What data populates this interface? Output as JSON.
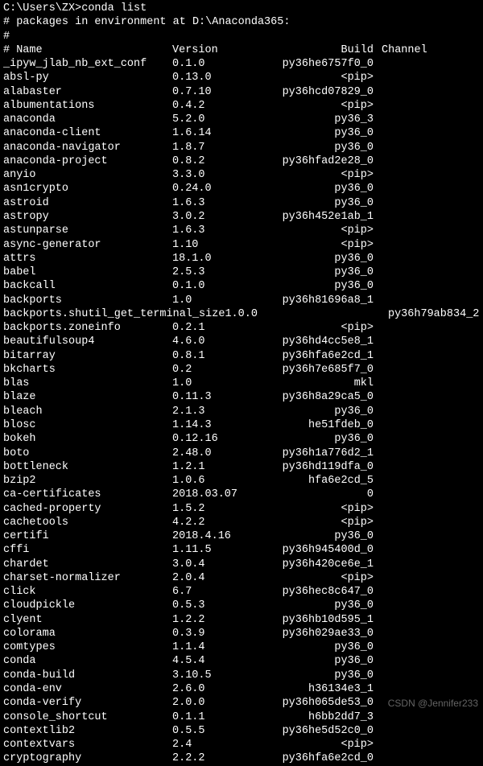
{
  "prompt": {
    "path": "C:\\Users\\ZX>",
    "command": "conda list"
  },
  "env_line": "# packages in environment at D:\\Anaconda365:",
  "hash_line": "#",
  "header": {
    "name": "# Name",
    "version": "Version",
    "build": "Build",
    "channel": "Channel"
  },
  "packages": [
    {
      "name": "_ipyw_jlab_nb_ext_conf",
      "version": "0.1.0",
      "build": "py36he6757f0_0",
      "channel": ""
    },
    {
      "name": "absl-py",
      "version": "0.13.0",
      "build": "<pip>",
      "channel": ""
    },
    {
      "name": "alabaster",
      "version": "0.7.10",
      "build": "py36hcd07829_0",
      "channel": ""
    },
    {
      "name": "albumentations",
      "version": "0.4.2",
      "build": "<pip>",
      "channel": ""
    },
    {
      "name": "anaconda",
      "version": "5.2.0",
      "build": "py36_3",
      "channel": ""
    },
    {
      "name": "anaconda-client",
      "version": "1.6.14",
      "build": "py36_0",
      "channel": ""
    },
    {
      "name": "anaconda-navigator",
      "version": "1.8.7",
      "build": "py36_0",
      "channel": ""
    },
    {
      "name": "anaconda-project",
      "version": "0.8.2",
      "build": "py36hfad2e28_0",
      "channel": ""
    },
    {
      "name": "anyio",
      "version": "3.3.0",
      "build": "<pip>",
      "channel": ""
    },
    {
      "name": "asn1crypto",
      "version": "0.24.0",
      "build": "py36_0",
      "channel": ""
    },
    {
      "name": "astroid",
      "version": "1.6.3",
      "build": "py36_0",
      "channel": ""
    },
    {
      "name": "astropy",
      "version": "3.0.2",
      "build": "py36h452e1ab_1",
      "channel": ""
    },
    {
      "name": "astunparse",
      "version": "1.6.3",
      "build": "<pip>",
      "channel": ""
    },
    {
      "name": "async-generator",
      "version": "1.10",
      "build": "<pip>",
      "channel": ""
    },
    {
      "name": "attrs",
      "version": "18.1.0",
      "build": "py36_0",
      "channel": ""
    },
    {
      "name": "babel",
      "version": "2.5.3",
      "build": "py36_0",
      "channel": ""
    },
    {
      "name": "backcall",
      "version": "0.1.0",
      "build": "py36_0",
      "channel": ""
    },
    {
      "name": "backports",
      "version": "1.0",
      "build": "py36h81696a8_1",
      "channel": ""
    },
    {
      "name": "backports.shutil_get_terminal_size",
      "version": "1.0.0",
      "build": "py36h79ab834_2",
      "channel": "",
      "wide": true
    },
    {
      "name": "backports.zoneinfo",
      "version": "0.2.1",
      "build": "<pip>",
      "channel": ""
    },
    {
      "name": "beautifulsoup4",
      "version": "4.6.0",
      "build": "py36hd4cc5e8_1",
      "channel": ""
    },
    {
      "name": "bitarray",
      "version": "0.8.1",
      "build": "py36hfa6e2cd_1",
      "channel": ""
    },
    {
      "name": "bkcharts",
      "version": "0.2",
      "build": "py36h7e685f7_0",
      "channel": ""
    },
    {
      "name": "blas",
      "version": "1.0",
      "build": "mkl",
      "channel": ""
    },
    {
      "name": "blaze",
      "version": "0.11.3",
      "build": "py36h8a29ca5_0",
      "channel": ""
    },
    {
      "name": "bleach",
      "version": "2.1.3",
      "build": "py36_0",
      "channel": ""
    },
    {
      "name": "blosc",
      "version": "1.14.3",
      "build": "he51fdeb_0",
      "channel": ""
    },
    {
      "name": "bokeh",
      "version": "0.12.16",
      "build": "py36_0",
      "channel": ""
    },
    {
      "name": "boto",
      "version": "2.48.0",
      "build": "py36h1a776d2_1",
      "channel": ""
    },
    {
      "name": "bottleneck",
      "version": "1.2.1",
      "build": "py36hd119dfa_0",
      "channel": ""
    },
    {
      "name": "bzip2",
      "version": "1.0.6",
      "build": "hfa6e2cd_5",
      "channel": ""
    },
    {
      "name": "ca-certificates",
      "version": "2018.03.07",
      "build": "0",
      "channel": ""
    },
    {
      "name": "cached-property",
      "version": "1.5.2",
      "build": "<pip>",
      "channel": ""
    },
    {
      "name": "cachetools",
      "version": "4.2.2",
      "build": "<pip>",
      "channel": ""
    },
    {
      "name": "certifi",
      "version": "2018.4.16",
      "build": "py36_0",
      "channel": ""
    },
    {
      "name": "cffi",
      "version": "1.11.5",
      "build": "py36h945400d_0",
      "channel": ""
    },
    {
      "name": "chardet",
      "version": "3.0.4",
      "build": "py36h420ce6e_1",
      "channel": ""
    },
    {
      "name": "charset-normalizer",
      "version": "2.0.4",
      "build": "<pip>",
      "channel": ""
    },
    {
      "name": "click",
      "version": "6.7",
      "build": "py36hec8c647_0",
      "channel": ""
    },
    {
      "name": "cloudpickle",
      "version": "0.5.3",
      "build": "py36_0",
      "channel": ""
    },
    {
      "name": "clyent",
      "version": "1.2.2",
      "build": "py36hb10d595_1",
      "channel": ""
    },
    {
      "name": "colorama",
      "version": "0.3.9",
      "build": "py36h029ae33_0",
      "channel": ""
    },
    {
      "name": "comtypes",
      "version": "1.1.4",
      "build": "py36_0",
      "channel": ""
    },
    {
      "name": "conda",
      "version": "4.5.4",
      "build": "py36_0",
      "channel": ""
    },
    {
      "name": "conda-build",
      "version": "3.10.5",
      "build": "py36_0",
      "channel": ""
    },
    {
      "name": "conda-env",
      "version": "2.6.0",
      "build": "h36134e3_1",
      "channel": ""
    },
    {
      "name": "conda-verify",
      "version": "2.0.0",
      "build": "py36h065de53_0",
      "channel": ""
    },
    {
      "name": "console_shortcut",
      "version": "0.1.1",
      "build": "h6bb2dd7_3",
      "channel": ""
    },
    {
      "name": "contextlib2",
      "version": "0.5.5",
      "build": "py36he5d52c0_0",
      "channel": ""
    },
    {
      "name": "contextvars",
      "version": "2.4",
      "build": "<pip>",
      "channel": ""
    },
    {
      "name": "cryptography",
      "version": "2.2.2",
      "build": "py36hfa6e2cd_0",
      "channel": ""
    }
  ],
  "watermark": "CSDN @Jennifer233"
}
